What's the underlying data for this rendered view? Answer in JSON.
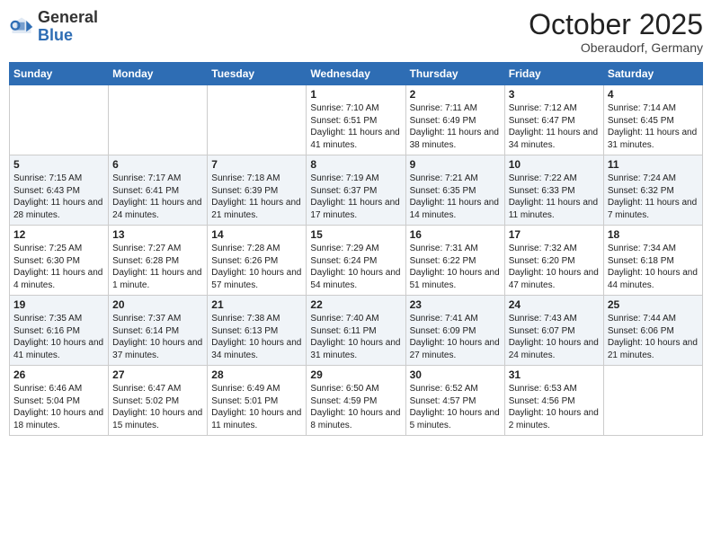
{
  "logo": {
    "general": "General",
    "blue": "Blue"
  },
  "header": {
    "month": "October 2025",
    "location": "Oberaudorf, Germany"
  },
  "days_of_week": [
    "Sunday",
    "Monday",
    "Tuesday",
    "Wednesday",
    "Thursday",
    "Friday",
    "Saturday"
  ],
  "weeks": [
    [
      {
        "day": "",
        "info": ""
      },
      {
        "day": "",
        "info": ""
      },
      {
        "day": "",
        "info": ""
      },
      {
        "day": "1",
        "info": "Sunrise: 7:10 AM\nSunset: 6:51 PM\nDaylight: 11 hours and 41 minutes."
      },
      {
        "day": "2",
        "info": "Sunrise: 7:11 AM\nSunset: 6:49 PM\nDaylight: 11 hours and 38 minutes."
      },
      {
        "day": "3",
        "info": "Sunrise: 7:12 AM\nSunset: 6:47 PM\nDaylight: 11 hours and 34 minutes."
      },
      {
        "day": "4",
        "info": "Sunrise: 7:14 AM\nSunset: 6:45 PM\nDaylight: 11 hours and 31 minutes."
      }
    ],
    [
      {
        "day": "5",
        "info": "Sunrise: 7:15 AM\nSunset: 6:43 PM\nDaylight: 11 hours and 28 minutes."
      },
      {
        "day": "6",
        "info": "Sunrise: 7:17 AM\nSunset: 6:41 PM\nDaylight: 11 hours and 24 minutes."
      },
      {
        "day": "7",
        "info": "Sunrise: 7:18 AM\nSunset: 6:39 PM\nDaylight: 11 hours and 21 minutes."
      },
      {
        "day": "8",
        "info": "Sunrise: 7:19 AM\nSunset: 6:37 PM\nDaylight: 11 hours and 17 minutes."
      },
      {
        "day": "9",
        "info": "Sunrise: 7:21 AM\nSunset: 6:35 PM\nDaylight: 11 hours and 14 minutes."
      },
      {
        "day": "10",
        "info": "Sunrise: 7:22 AM\nSunset: 6:33 PM\nDaylight: 11 hours and 11 minutes."
      },
      {
        "day": "11",
        "info": "Sunrise: 7:24 AM\nSunset: 6:32 PM\nDaylight: 11 hours and 7 minutes."
      }
    ],
    [
      {
        "day": "12",
        "info": "Sunrise: 7:25 AM\nSunset: 6:30 PM\nDaylight: 11 hours and 4 minutes."
      },
      {
        "day": "13",
        "info": "Sunrise: 7:27 AM\nSunset: 6:28 PM\nDaylight: 11 hours and 1 minute."
      },
      {
        "day": "14",
        "info": "Sunrise: 7:28 AM\nSunset: 6:26 PM\nDaylight: 10 hours and 57 minutes."
      },
      {
        "day": "15",
        "info": "Sunrise: 7:29 AM\nSunset: 6:24 PM\nDaylight: 10 hours and 54 minutes."
      },
      {
        "day": "16",
        "info": "Sunrise: 7:31 AM\nSunset: 6:22 PM\nDaylight: 10 hours and 51 minutes."
      },
      {
        "day": "17",
        "info": "Sunrise: 7:32 AM\nSunset: 6:20 PM\nDaylight: 10 hours and 47 minutes."
      },
      {
        "day": "18",
        "info": "Sunrise: 7:34 AM\nSunset: 6:18 PM\nDaylight: 10 hours and 44 minutes."
      }
    ],
    [
      {
        "day": "19",
        "info": "Sunrise: 7:35 AM\nSunset: 6:16 PM\nDaylight: 10 hours and 41 minutes."
      },
      {
        "day": "20",
        "info": "Sunrise: 7:37 AM\nSunset: 6:14 PM\nDaylight: 10 hours and 37 minutes."
      },
      {
        "day": "21",
        "info": "Sunrise: 7:38 AM\nSunset: 6:13 PM\nDaylight: 10 hours and 34 minutes."
      },
      {
        "day": "22",
        "info": "Sunrise: 7:40 AM\nSunset: 6:11 PM\nDaylight: 10 hours and 31 minutes."
      },
      {
        "day": "23",
        "info": "Sunrise: 7:41 AM\nSunset: 6:09 PM\nDaylight: 10 hours and 27 minutes."
      },
      {
        "day": "24",
        "info": "Sunrise: 7:43 AM\nSunset: 6:07 PM\nDaylight: 10 hours and 24 minutes."
      },
      {
        "day": "25",
        "info": "Sunrise: 7:44 AM\nSunset: 6:06 PM\nDaylight: 10 hours and 21 minutes."
      }
    ],
    [
      {
        "day": "26",
        "info": "Sunrise: 6:46 AM\nSunset: 5:04 PM\nDaylight: 10 hours and 18 minutes."
      },
      {
        "day": "27",
        "info": "Sunrise: 6:47 AM\nSunset: 5:02 PM\nDaylight: 10 hours and 15 minutes."
      },
      {
        "day": "28",
        "info": "Sunrise: 6:49 AM\nSunset: 5:01 PM\nDaylight: 10 hours and 11 minutes."
      },
      {
        "day": "29",
        "info": "Sunrise: 6:50 AM\nSunset: 4:59 PM\nDaylight: 10 hours and 8 minutes."
      },
      {
        "day": "30",
        "info": "Sunrise: 6:52 AM\nSunset: 4:57 PM\nDaylight: 10 hours and 5 minutes."
      },
      {
        "day": "31",
        "info": "Sunrise: 6:53 AM\nSunset: 4:56 PM\nDaylight: 10 hours and 2 minutes."
      },
      {
        "day": "",
        "info": ""
      }
    ]
  ]
}
